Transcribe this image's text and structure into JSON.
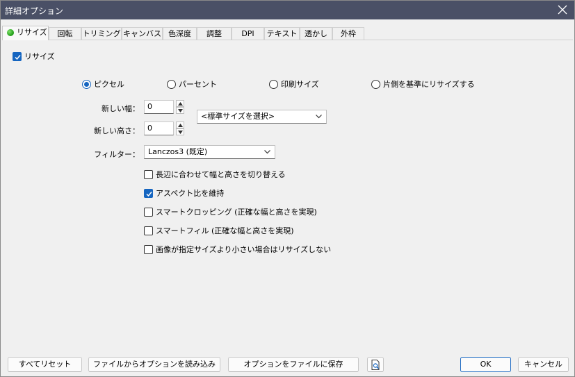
{
  "window": {
    "title": "詳細オプション"
  },
  "tabs": [
    {
      "label": "リサイズ",
      "active": true
    },
    {
      "label": "回転"
    },
    {
      "label": "トリミング"
    },
    {
      "label": "キャンバス"
    },
    {
      "label": "色深度"
    },
    {
      "label": "調整"
    },
    {
      "label": "DPI"
    },
    {
      "label": "テキスト"
    },
    {
      "label": "透かし"
    },
    {
      "label": "外枠"
    }
  ],
  "resize": {
    "enable_label": "リサイズ",
    "enable_checked": true,
    "units": {
      "pixel": "ピクセル",
      "percent": "パーセント",
      "print": "印刷サイズ",
      "one_side": "片側を基準にリサイズする",
      "selected": "pixel"
    },
    "width_label": "新しい幅：",
    "width_value": "0",
    "height_label": "新しい高さ：",
    "height_value": "0",
    "preset_value": "<標準サイズを選択>",
    "filter_label": "フィルター：",
    "filter_value": "Lanczos3 (既定)",
    "options": [
      {
        "label": "長辺に合わせて幅と高さを切り替える",
        "checked": false
      },
      {
        "label": "アスペクト比を維持",
        "checked": true
      },
      {
        "label": "スマートクロッピング (正確な幅と高さを実現)",
        "checked": false
      },
      {
        "label": "スマートフィル (正確な幅と高さを実現)",
        "checked": false
      },
      {
        "label": "画像が指定サイズより小さい場合はリサイズしない",
        "checked": false
      }
    ]
  },
  "footer": {
    "reset_all": "すべてリセット",
    "load_from_file": "ファイルからオプションを読み込み",
    "save_to_file": "オプションをファイルに保存",
    "ok": "OK",
    "cancel": "キャンセル"
  },
  "colors": {
    "titlebar": "#4a5066",
    "accent": "#1565c0",
    "tab_indicator": "#1c9a13"
  }
}
